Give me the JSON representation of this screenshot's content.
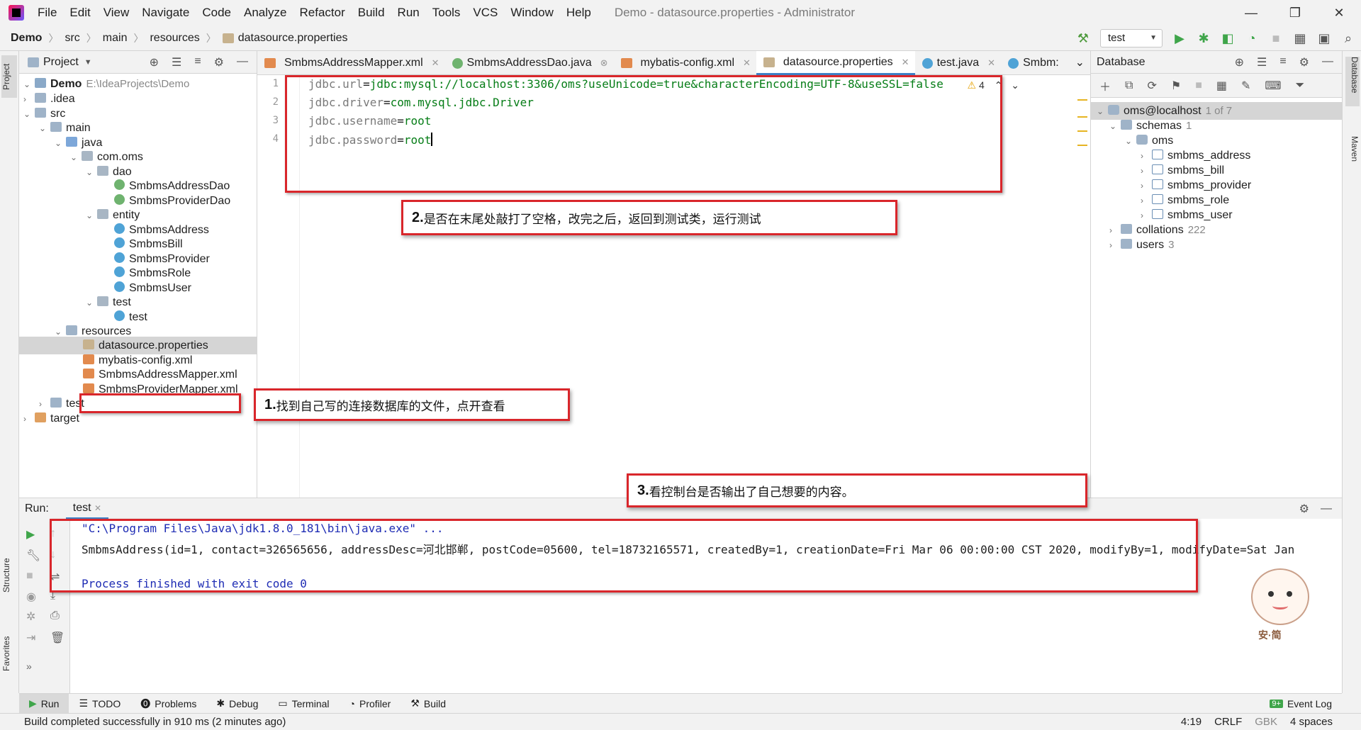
{
  "window": {
    "title": "Demo - datasource.properties - Administrator",
    "menu": [
      "File",
      "Edit",
      "View",
      "Navigate",
      "Code",
      "Analyze",
      "Refactor",
      "Build",
      "Run",
      "Tools",
      "VCS",
      "Window",
      "Help"
    ]
  },
  "breadcrumb": [
    "Demo",
    "src",
    "main",
    "resources",
    "datasource.properties"
  ],
  "run_config": "test",
  "project_panel": {
    "title": "Project",
    "tree": [
      {
        "label": "Demo",
        "extra": "E:\\IdeaProjects\\Demo",
        "bold": true
      },
      {
        "label": ".idea"
      },
      {
        "label": "src"
      },
      {
        "label": "main"
      },
      {
        "label": "java"
      },
      {
        "label": "com.oms"
      },
      {
        "label": "dao"
      },
      {
        "label": "SmbmsAddressDao"
      },
      {
        "label": "SmbmsProviderDao"
      },
      {
        "label": "entity"
      },
      {
        "label": "SmbmsAddress"
      },
      {
        "label": "SmbmsBill"
      },
      {
        "label": "SmbmsProvider"
      },
      {
        "label": "SmbmsRole"
      },
      {
        "label": "SmbmsUser"
      },
      {
        "label": "test"
      },
      {
        "label": "test"
      },
      {
        "label": "resources"
      },
      {
        "label": "datasource.properties"
      },
      {
        "label": "mybatis-config.xml"
      },
      {
        "label": "SmbmsAddressMapper.xml"
      },
      {
        "label": "SmbmsProviderMapper.xml"
      },
      {
        "label": "test"
      },
      {
        "label": "target"
      }
    ]
  },
  "editor_tabs": [
    "SmbmsAddressMapper.xml",
    "SmbmsAddressDao.java",
    "mybatis-config.xml",
    "datasource.properties",
    "test.java",
    "Smbm:"
  ],
  "editor": {
    "lines": [
      {
        "num": "1",
        "key": "jdbc.url",
        "value": "jdbc:mysql://localhost:3306/oms?useUnicode=true&characterEncoding=UTF-8&useSSL=false"
      },
      {
        "num": "2",
        "key": "jdbc.driver",
        "value": "com.mysql.jdbc.Driver"
      },
      {
        "num": "3",
        "key": "jdbc.username",
        "value": "root"
      },
      {
        "num": "4",
        "key": "jdbc.password",
        "value": "root"
      }
    ],
    "warnings": "4"
  },
  "database_panel": {
    "title": "Database",
    "connection": "oms@localhost",
    "connection_meta": "1 of 7",
    "schemas_label": "schemas",
    "schemas_count": "1",
    "schema": "oms",
    "tables": [
      "smbms_address",
      "smbms_bill",
      "smbms_provider",
      "smbms_role",
      "smbms_user"
    ],
    "collations_label": "collations",
    "collations_count": "222",
    "users_label": "users",
    "users_count": "3"
  },
  "run_panel": {
    "label": "Run:",
    "tab": "test",
    "console": [
      "\"C:\\Program Files\\Java\\jdk1.8.0_181\\bin\\java.exe\" ...",
      "SmbmsAddress(id=1, contact=326565656, addressDesc=河北邯郸, postCode=05600, tel=18732165571, createdBy=1, creationDate=Fri Mar 06 00:00:00 CST 2020, modifyBy=1, modifyDate=Sat Jan",
      "",
      "Process finished with exit code 0"
    ]
  },
  "tool_tabs": [
    "Run",
    "TODO",
    "Problems",
    "Debug",
    "Terminal",
    "Profiler",
    "Build"
  ],
  "event_log": "Event Log",
  "event_log_badge": "9+",
  "status": {
    "message": "Build completed successfully in 910 ms (2 minutes ago)",
    "position": "4:19",
    "line_sep": "CRLF",
    "encoding": "GBK",
    "indent": "4 spaces"
  },
  "side_tabs": {
    "left": [
      "Project",
      "Structure",
      "Favorites"
    ],
    "right": [
      "Database",
      "Maven"
    ]
  },
  "annotations": {
    "note1_num": "1.",
    "note1_text": "找到自己写的连接数据库的文件，点开查看",
    "note2_num": "2.",
    "note2_text": "是否在末尾处敲打了空格，改完之后，返回到测试类，运行测试",
    "note3_num": "3.",
    "note3_text": "看控制台是否输出了自己想要的内容。"
  },
  "sticker_text": "安·简",
  "colors": {
    "accent": "#4083c9",
    "annotation_red": "#d9262b",
    "property_value": "#067d17",
    "console_blue": "#1e2cb4"
  }
}
